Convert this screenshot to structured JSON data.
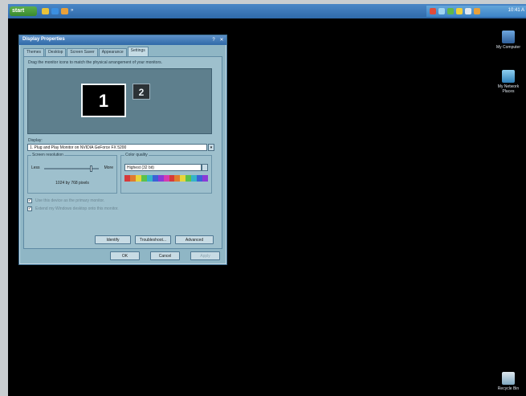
{
  "taskbar": {
    "start_label": "start",
    "clock": "10:41 A"
  },
  "desktop": {
    "icons": [
      {
        "label": "My Computer",
        "icon": "computer-icon"
      },
      {
        "label": "My Network Places",
        "icon": "network-icon"
      },
      {
        "label": "Recycle Bin",
        "icon": "recycle-bin-icon"
      }
    ]
  },
  "dialog": {
    "title": "Display Properties",
    "tabs": [
      "Themes",
      "Desktop",
      "Screen Saver",
      "Appearance",
      "Settings"
    ],
    "active_tab": "Settings",
    "instruction": "Drag the monitor icons to match the physical arrangement of your monitors.",
    "monitors": [
      "1",
      "2"
    ],
    "display_label": "Display:",
    "display_value": "1. Plug and Play Monitor on NVIDIA GeForce FX 5200",
    "resolution": {
      "label": "Screen resolution",
      "less": "Less",
      "more": "More",
      "value": "1024 by 768 pixels",
      "slider_position": 0.88
    },
    "color": {
      "label": "Color quality",
      "value": "Highest (32 bit)",
      "swatches": [
        "#d63a3a",
        "#e07c2e",
        "#e7d53a",
        "#5bc24b",
        "#34b3c9",
        "#3a62d6",
        "#8a3ad6",
        "#d63ab0",
        "#d63a3a",
        "#e07c2e",
        "#e7d53a",
        "#5bc24b",
        "#34b3c9",
        "#3a62d6",
        "#8a3ad6"
      ]
    },
    "checkboxes": [
      {
        "label": "Use this device as the primary monitor.",
        "checked": true
      },
      {
        "label": "Extend my Windows desktop onto this monitor.",
        "checked": true
      }
    ],
    "buttons": {
      "identify": "Identify",
      "troubleshoot": "Troubleshoot...",
      "advanced": "Advanced",
      "ok": "OK",
      "cancel": "Cancel",
      "apply": "Apply"
    }
  }
}
